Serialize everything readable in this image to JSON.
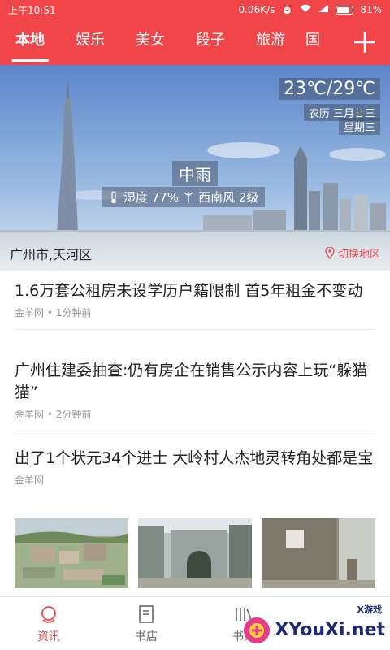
{
  "status_bar": {
    "time": "上午10:51",
    "network_speed": "0.06K/s",
    "battery": "81%"
  },
  "tabs": [
    {
      "label": "本地",
      "active": true
    },
    {
      "label": "娱乐",
      "active": false
    },
    {
      "label": "美女",
      "active": false
    },
    {
      "label": "段子",
      "active": false
    },
    {
      "label": "旅游",
      "active": false
    },
    {
      "label": "国",
      "active": false
    }
  ],
  "add_button_icon": "plus-icon",
  "weather": {
    "temperature": "23℃/29℃",
    "lunar_date": "农历  三月廿三",
    "weekday": "星期三",
    "condition": "中雨",
    "humidity": "湿度 77%",
    "wind": "西南风 2级",
    "location": "广州市,天河区",
    "switch_label": "切换地区"
  },
  "news": [
    {
      "title": "1.6万套公租房未设学历户籍限制 首5年租金不变动",
      "source": "金羊网 • 1分钟前"
    },
    {
      "title": "广州住建委抽查:仍有房企在销售公示内容上玩“躲猫猫”",
      "source": "金羊网 • 2分钟前"
    },
    {
      "title": "出了1个状元34个进士 大岭村人杰地灵转角处都是宝",
      "source": "金羊网"
    }
  ],
  "bottom_nav": [
    {
      "label": "资讯",
      "icon": "news-globe-icon",
      "active": true
    },
    {
      "label": "书店",
      "icon": "bookstore-icon",
      "active": false
    },
    {
      "label": "书架",
      "icon": "bookshelf-icon",
      "active": false
    }
  ],
  "watermark": {
    "text": "XYouXi.net",
    "small": "X游戏"
  },
  "colors": {
    "accent": "#f0464a",
    "active_nav": "#e64c4c",
    "meta_text": "#999999"
  }
}
